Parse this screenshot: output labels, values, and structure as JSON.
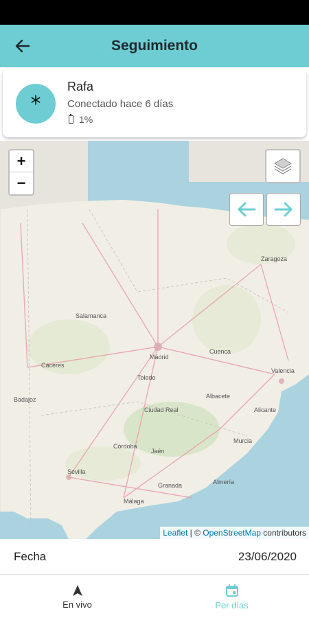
{
  "header": {
    "title": "Seguimiento",
    "back_icon": "arrow-left-icon"
  },
  "device": {
    "avatar_symbol": "*",
    "name": "Rafa",
    "status": "Conectado hace 6 días",
    "battery_icon": "battery-icon",
    "battery": "1%"
  },
  "map": {
    "zoom_in": "+",
    "zoom_out": "−",
    "layers_icon": "layers-icon",
    "prev_icon": "arrow-left-icon",
    "next_icon": "arrow-right-icon",
    "attribution": {
      "leaflet": "Leaflet",
      "separator": " | © ",
      "osm": "OpenStreetMap",
      "contributors": " contributors"
    },
    "labels": [
      "Madrid",
      "Sevilla",
      "Granada",
      "Valencia",
      "Zaragoza",
      "Murcia",
      "Córdoba",
      "Salamanca",
      "Almería",
      "Málaga",
      "Cuenca",
      "Toledo",
      "Ciudad Real",
      "Albacete",
      "Alicante",
      "Badajoz",
      "Cáceres",
      "Jaén"
    ]
  },
  "date_row": {
    "label": "Fecha",
    "value": "23/06/2020"
  },
  "bottom_nav": {
    "items": [
      {
        "label": "En vivo",
        "icon": "navigation-arrow-icon"
      },
      {
        "label": "Por días",
        "icon": "calendar-icon"
      }
    ]
  },
  "colors": {
    "accent": "#6dcdd3",
    "map_land": "#f1eee6",
    "map_sea": "#aad3df"
  }
}
